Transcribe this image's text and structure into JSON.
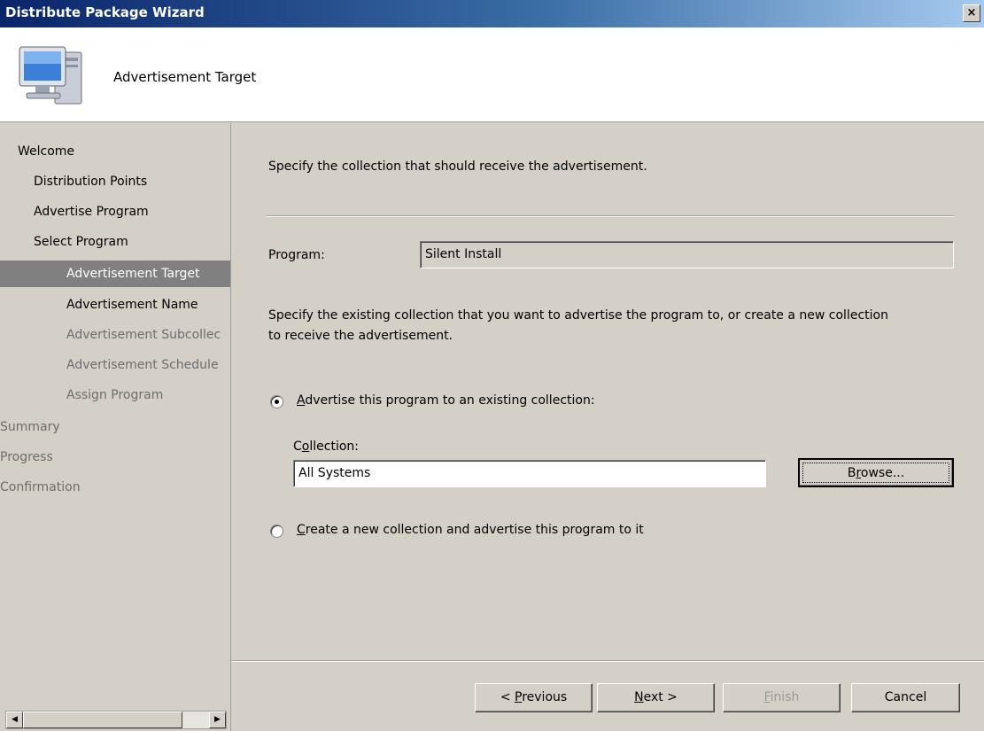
{
  "window": {
    "title": "Distribute Package Wizard",
    "close_glyph": "×"
  },
  "header": {
    "icon": "computer-icon",
    "heading": "Advertisement Target"
  },
  "nav": {
    "items": [
      {
        "label": "Welcome",
        "state": "normal"
      },
      {
        "label": "Distribution Points",
        "state": "normal"
      },
      {
        "label": "Advertise Program",
        "state": "normal"
      },
      {
        "label": "Select Program",
        "state": "normal"
      },
      {
        "label": "Advertisement Target",
        "state": "selected"
      },
      {
        "label": "Advertisement Name",
        "state": "normal"
      },
      {
        "label": "Advertisement Subcollec",
        "state": "muted"
      },
      {
        "label": "Advertisement Schedule",
        "state": "muted"
      },
      {
        "label": "Assign Program",
        "state": "muted"
      },
      {
        "label": "Summary",
        "state": "muted"
      },
      {
        "label": "Progress",
        "state": "muted"
      },
      {
        "label": "Confirmation",
        "state": "muted"
      }
    ]
  },
  "content": {
    "intro": "Specify the collection that should receive the advertisement.",
    "program_label": "Program:",
    "program_value": "Silent Install",
    "instructions_line1": "Specify the existing collection that you want to advertise the program to, or create a new collection",
    "instructions_line2": "to receive the advertisement.",
    "option_existing": {
      "mnemonic": "A",
      "rest": "dvertise this program to an existing collection:",
      "selected": true
    },
    "collection_label": {
      "first": "C",
      "mnemonic": "o",
      "rest": "llection:"
    },
    "collection_value": "All Systems",
    "browse": {
      "first": "B",
      "mnemonic": "r",
      "rest": "owse..."
    },
    "option_new": {
      "mnemonic": "C",
      "rest": "reate a new collection and advertise this program to it",
      "selected": false
    }
  },
  "footer": {
    "previous": {
      "before": "< ",
      "mnemonic": "P",
      "rest": "revious"
    },
    "next": {
      "mnemonic": "N",
      "rest": "ext >"
    },
    "finish": {
      "mnemonic": "F",
      "rest": "inish"
    },
    "cancel": "Cancel"
  }
}
